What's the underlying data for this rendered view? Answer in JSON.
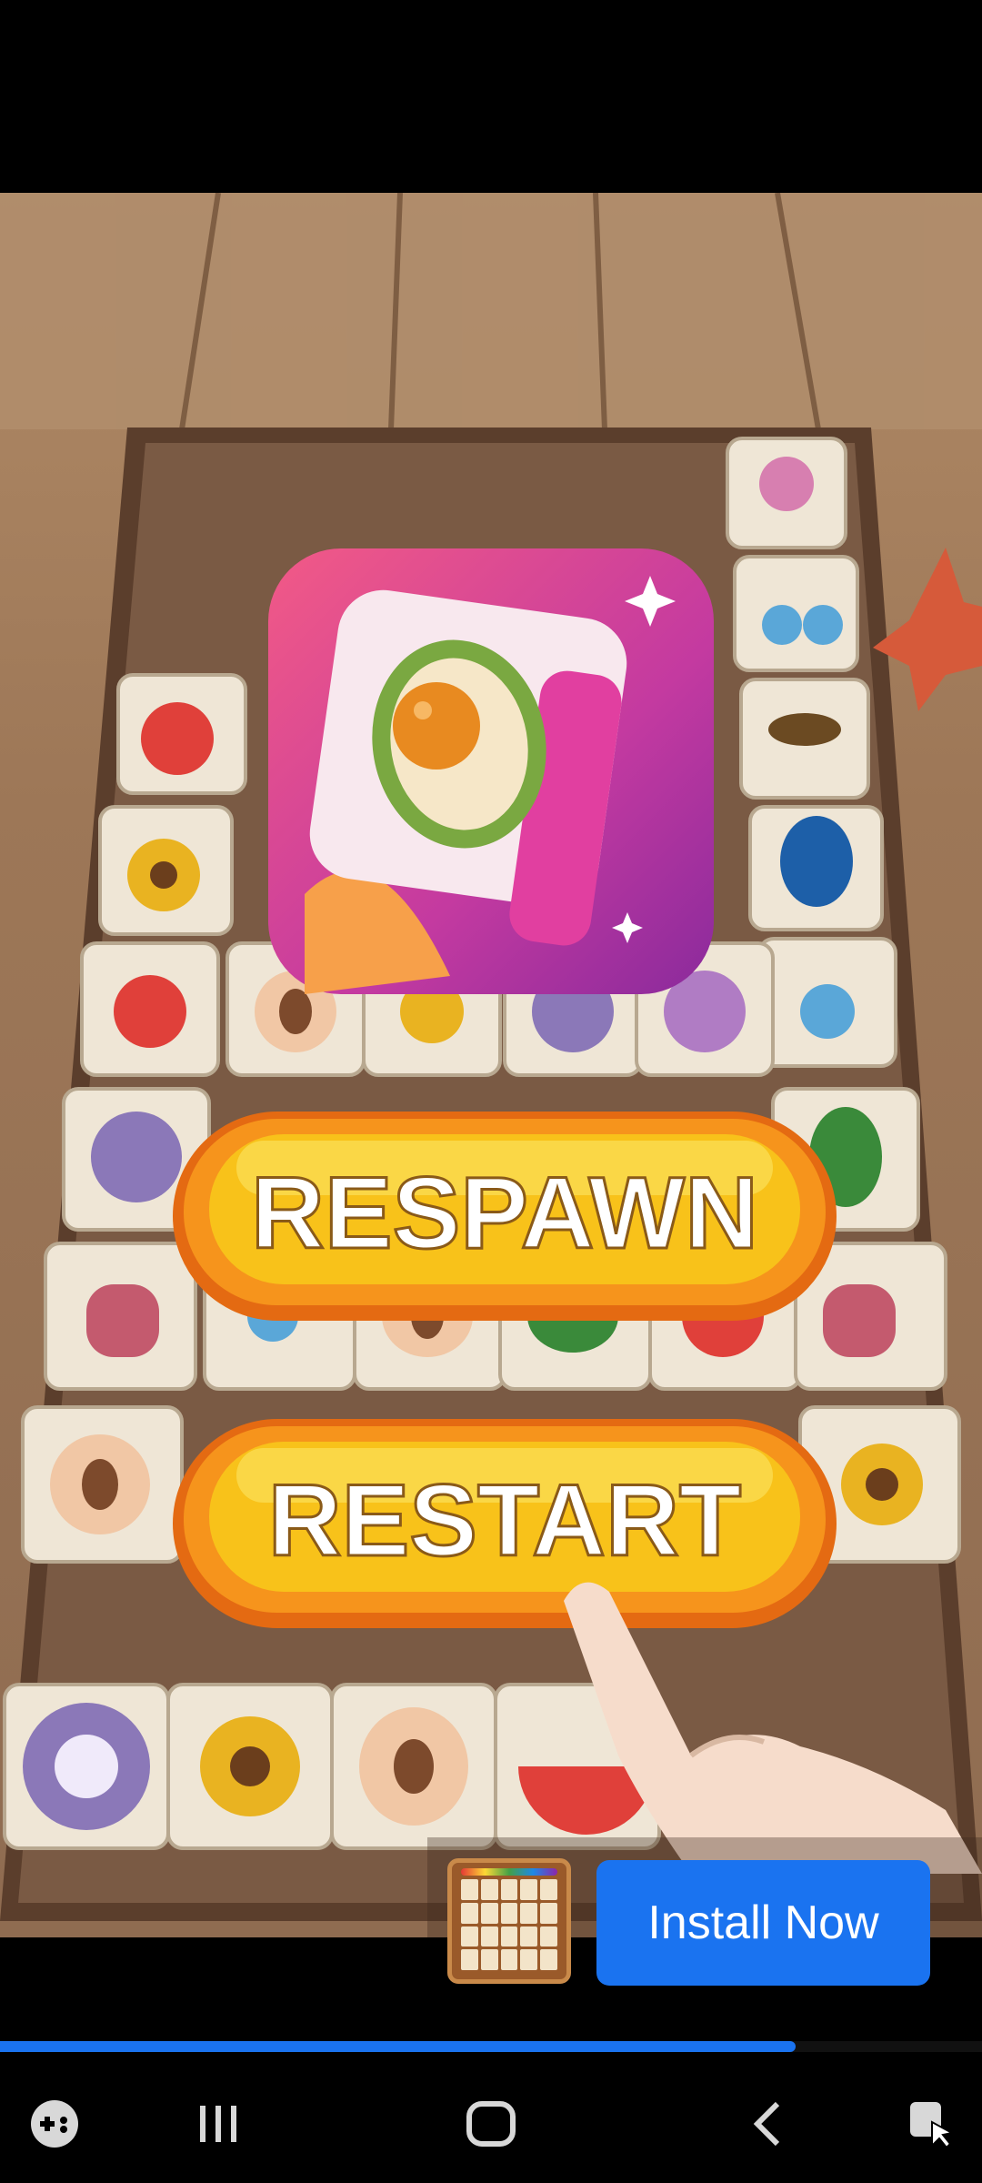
{
  "game": {
    "respawn_label": "RESPAWN",
    "restart_label": "RESTART"
  },
  "ad": {
    "install_label": "Install Now",
    "progress_fraction": 0.81
  },
  "navbar": {
    "icons": [
      "gamepad-icon",
      "recent-apps-icon",
      "home-icon",
      "back-icon",
      "screenshot-cursor-icon"
    ]
  },
  "colors": {
    "accent": "#1a73f0",
    "button_yellow": "#f7c21a",
    "button_orange": "#f08a12",
    "app_icon_pink": "#e8508a"
  }
}
